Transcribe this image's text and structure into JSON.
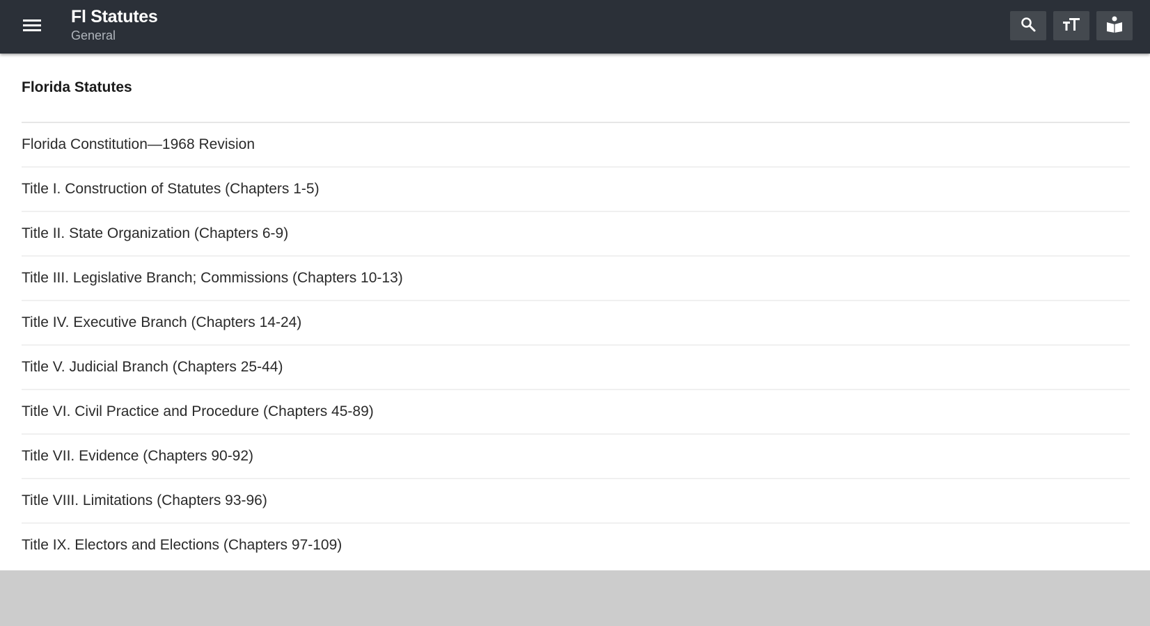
{
  "appbar": {
    "title": "Fl Statutes",
    "subtitle": "General",
    "icons": {
      "menu": "menu-icon",
      "search": "search-icon",
      "text_size": "text-size-icon",
      "reader": "reader-icon"
    },
    "background": "#2b3038"
  },
  "main": {
    "section_title": "Florida Statutes",
    "items": [
      {
        "label": "Florida Constitution—1968 Revision"
      },
      {
        "label": "Title I. Construction of Statutes (Chapters 1-5)"
      },
      {
        "label": "Title II. State Organization (Chapters 6-9)"
      },
      {
        "label": "Title III. Legislative Branch; Commissions (Chapters 10-13)"
      },
      {
        "label": "Title IV. Executive Branch (Chapters 14-24)"
      },
      {
        "label": "Title V. Judicial Branch (Chapters 25-44)"
      },
      {
        "label": "Title VI. Civil Practice and Procedure (Chapters 45-89)"
      },
      {
        "label": "Title VII. Evidence (Chapters 90-92)"
      },
      {
        "label": "Title VIII. Limitations (Chapters 93-96)"
      },
      {
        "label": "Title IX. Electors and Elections (Chapters 97-109)"
      }
    ]
  }
}
